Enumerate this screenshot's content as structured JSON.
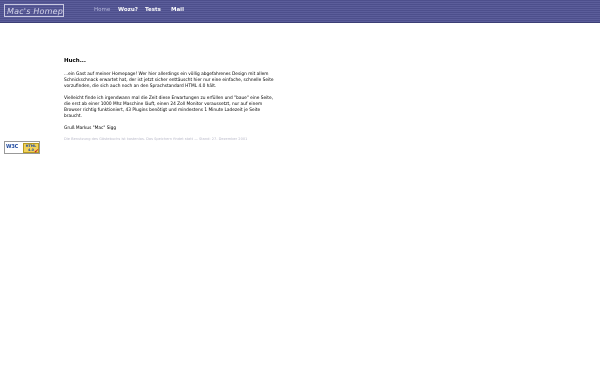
{
  "header": {
    "logo_text": "Mac's Homepage",
    "nav": [
      {
        "label": "Home"
      },
      {
        "label": "Wozu?"
      },
      {
        "label": "Tests"
      },
      {
        "label": "Mail"
      }
    ]
  },
  "main": {
    "heading": "Huch...",
    "paragraphs": [
      "...ein Gast auf meiner Homepage! Wer hier allerdings ein völlig abgefahrenes Design mit allem Schnickschnack erwartet hat, der ist jetzt sicher enttäuscht hier nur eine einfache, schnelle Seite vorzufinden, die sich auch noch an den Sprachstandard HTML 4.0 hält.",
      "Vielleicht finde ich irgendwann mal die Zeit diese Erwartungen zu erfüllen und \"baue\" eine Seite, die erst ab einer 1000 Mhz Maschine läuft, einen 24 Zoll Monitor voraussetzt, nur auf einem Browser richtig funktioniert, 43 Plugins benötigt und mindestens 1 Minute Ladezeit je Seite braucht.",
      "Gruß Markus \"Mac\" Sigg"
    ],
    "footnote": "Die Benutzung des Gästebuchs ist kostenlos. Das Speichern findet statt — Stand: 27. Dezember 2001"
  },
  "badge": {
    "w3c": "W3C",
    "html": "HTML 4.0",
    "check": "✔"
  }
}
